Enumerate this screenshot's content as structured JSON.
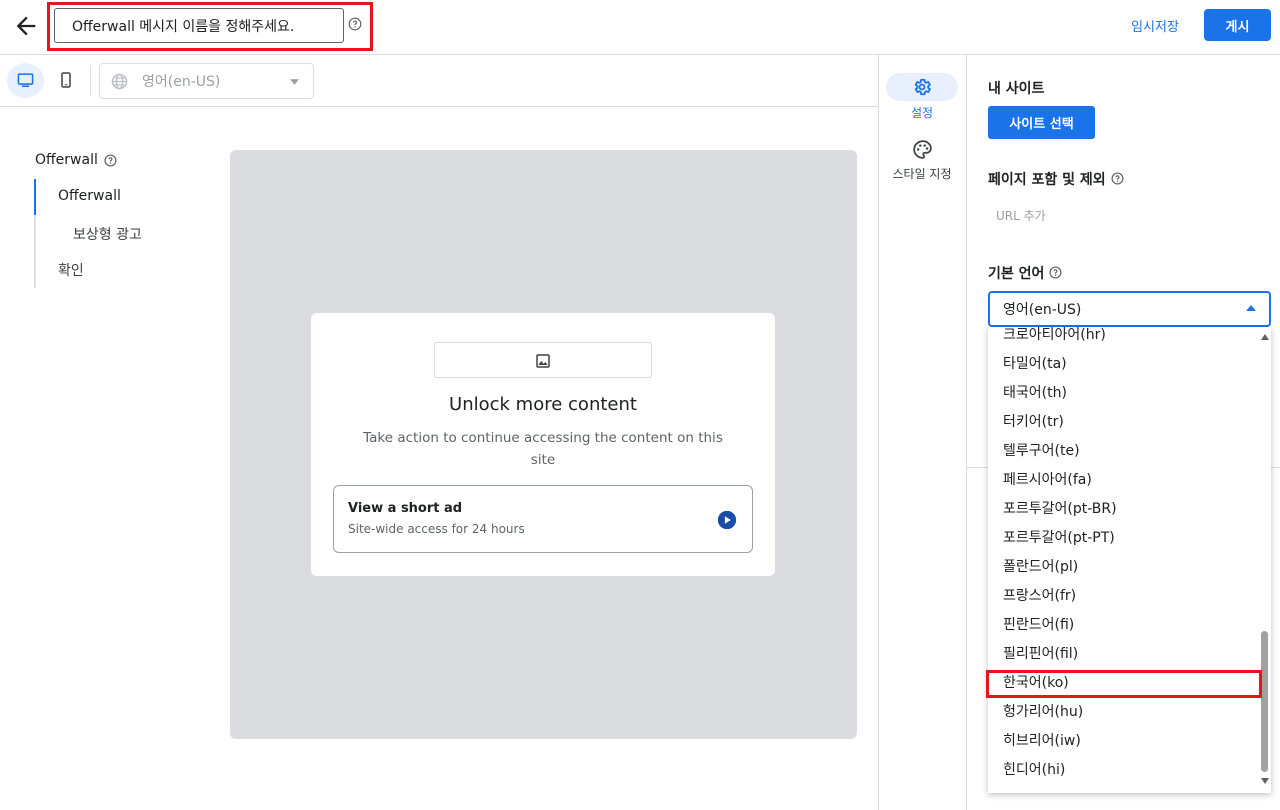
{
  "header": {
    "message_name": "Offerwall 메시지 이름을 정해주세요.",
    "save_draft_label": "임시저장",
    "publish_label": "게시"
  },
  "toolbar": {
    "language_value": "영어(en-US)"
  },
  "nav": {
    "title": "Offerwall",
    "items": [
      "Offerwall",
      "보상형 광고",
      "확인"
    ]
  },
  "preview": {
    "title": "Unlock more content",
    "description": "Take action to continue accessing the content on this site",
    "option_title": "View a short ad",
    "option_subtitle": "Site-wide access for 24 hours"
  },
  "rail": {
    "settings_label": "설정",
    "style_label": "스타일 지정"
  },
  "settings": {
    "my_site_title": "내 사이트",
    "site_button": "사이트 선택",
    "pages_title": "페이지 포함 및 제외",
    "url_add": "URL 추가",
    "language_title": "기본 언어",
    "language_value": "영어(en-US)"
  },
  "language_options": [
    "크로아티아어(hr)",
    "타밀어(ta)",
    "태국어(th)",
    "터키어(tr)",
    "텔루구어(te)",
    "페르시아어(fa)",
    "포르투갈어(pt-BR)",
    "포르투갈어(pt-PT)",
    "폴란드어(pl)",
    "프랑스어(fr)",
    "핀란드어(fi)",
    "필리핀어(fil)",
    "한국어(ko)",
    "헝가리어(hu)",
    "히브리어(iw)",
    "힌디어(hi)"
  ],
  "colors": {
    "accent": "#1a73e8",
    "highlight_box": "#e8141b",
    "preview_bg": "#dadce0"
  },
  "icons": [
    "back-arrow-icon",
    "help-icon",
    "desktop-icon",
    "mobile-icon",
    "globe-icon",
    "dropdown-caret-icon",
    "image-icon",
    "play-icon",
    "gear-icon",
    "palette-icon"
  ]
}
